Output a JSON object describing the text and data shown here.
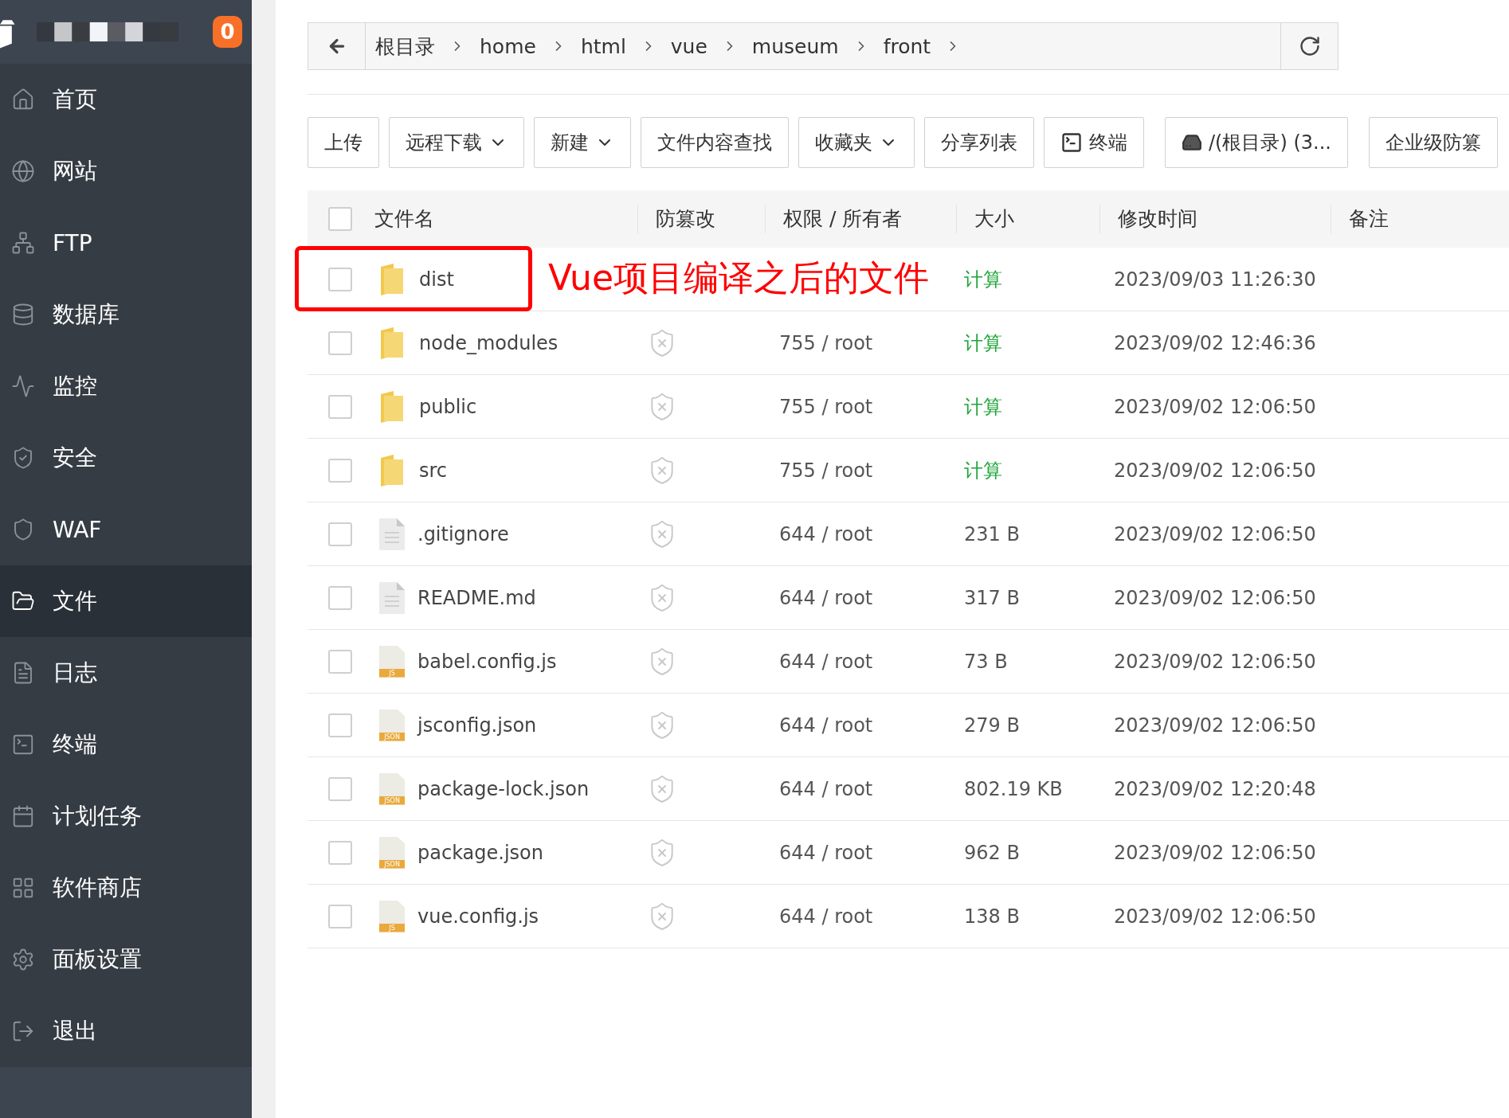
{
  "sidebar": {
    "badge": "0",
    "items": [
      {
        "label": "首页",
        "selected": false
      },
      {
        "label": "网站",
        "selected": false
      },
      {
        "label": "FTP",
        "selected": false
      },
      {
        "label": "数据库",
        "selected": false
      },
      {
        "label": "监控",
        "selected": false
      },
      {
        "label": "安全",
        "selected": false
      },
      {
        "label": "WAF",
        "selected": false
      },
      {
        "label": "文件",
        "selected": true
      },
      {
        "label": "日志",
        "selected": false
      },
      {
        "label": "终端",
        "selected": false
      },
      {
        "label": "计划任务",
        "selected": false
      },
      {
        "label": "软件商店",
        "selected": false
      },
      {
        "label": "面板设置",
        "selected": false
      },
      {
        "label": "退出",
        "selected": false
      }
    ]
  },
  "breadcrumb": [
    "根目录",
    "home",
    "html",
    "vue",
    "museum",
    "front"
  ],
  "toolbar": [
    {
      "label": "上传",
      "dropdown": false
    },
    {
      "label": "远程下载",
      "dropdown": true
    },
    {
      "label": "新建",
      "dropdown": true
    },
    {
      "label": "文件内容查找",
      "dropdown": false
    },
    {
      "label": "收藏夹",
      "dropdown": true
    },
    {
      "label": "分享列表",
      "dropdown": false
    },
    {
      "label": "终端",
      "dropdown": false,
      "kind": "terminal"
    },
    {
      "label": "/(根目录) (3...",
      "dropdown": false,
      "kind": "disk"
    },
    {
      "label": "企业级防篡",
      "dropdown": false
    }
  ],
  "table": {
    "all_checked": false,
    "columns": [
      "文件名",
      "防篡改",
      "权限 / 所有者",
      "大小",
      "修改时间",
      "备注"
    ],
    "rows": [
      {
        "name": "dist",
        "kind": "folder",
        "checked": false,
        "size": "计算",
        "size_link": true,
        "modified": "2023/09/03 11:26:30",
        "annotation": "Vue项目编译之后的文件"
      },
      {
        "name": "node_modules",
        "kind": "folder",
        "checked": false,
        "tamper_protected": false,
        "perm": "755 / root",
        "size": "计算",
        "size_link": true,
        "modified": "2023/09/02 12:46:36"
      },
      {
        "name": "public",
        "kind": "folder",
        "checked": false,
        "tamper_protected": false,
        "perm": "755 / root",
        "size": "计算",
        "size_link": true,
        "modified": "2023/09/02 12:06:50"
      },
      {
        "name": "src",
        "kind": "folder",
        "checked": false,
        "tamper_protected": false,
        "perm": "755 / root",
        "size": "计算",
        "size_link": true,
        "modified": "2023/09/02 12:06:50"
      },
      {
        "name": ".gitignore",
        "kind": "text",
        "checked": false,
        "tamper_protected": false,
        "perm": "644 / root",
        "size": "231 B",
        "size_link": false,
        "modified": "2023/09/02 12:06:50"
      },
      {
        "name": "README.md",
        "kind": "text",
        "checked": false,
        "tamper_protected": false,
        "perm": "644 / root",
        "size": "317 B",
        "size_link": false,
        "modified": "2023/09/02 12:06:50"
      },
      {
        "name": "babel.config.js",
        "kind": "code",
        "icon_label": "JS",
        "checked": false,
        "tamper_protected": false,
        "perm": "644 / root",
        "size": "73 B",
        "size_link": false,
        "modified": "2023/09/02 12:06:50"
      },
      {
        "name": "jsconfig.json",
        "kind": "code",
        "icon_label": "JSON",
        "checked": false,
        "tamper_protected": false,
        "perm": "644 / root",
        "size": "279 B",
        "size_link": false,
        "modified": "2023/09/02 12:06:50"
      },
      {
        "name": "package-lock.json",
        "kind": "code",
        "icon_label": "JSON",
        "checked": false,
        "tamper_protected": false,
        "perm": "644 / root",
        "size": "802.19 KB",
        "size_link": false,
        "modified": "2023/09/02 12:20:48"
      },
      {
        "name": "package.json",
        "kind": "code",
        "icon_label": "JSON",
        "checked": false,
        "tamper_protected": false,
        "perm": "644 / root",
        "size": "962 B",
        "size_link": false,
        "modified": "2023/09/02 12:06:50"
      },
      {
        "name": "vue.config.js",
        "kind": "code",
        "icon_label": "JS",
        "checked": false,
        "tamper_protected": false,
        "perm": "644 / root",
        "size": "138 B",
        "size_link": false,
        "modified": "2023/09/02 12:06:50"
      }
    ]
  }
}
